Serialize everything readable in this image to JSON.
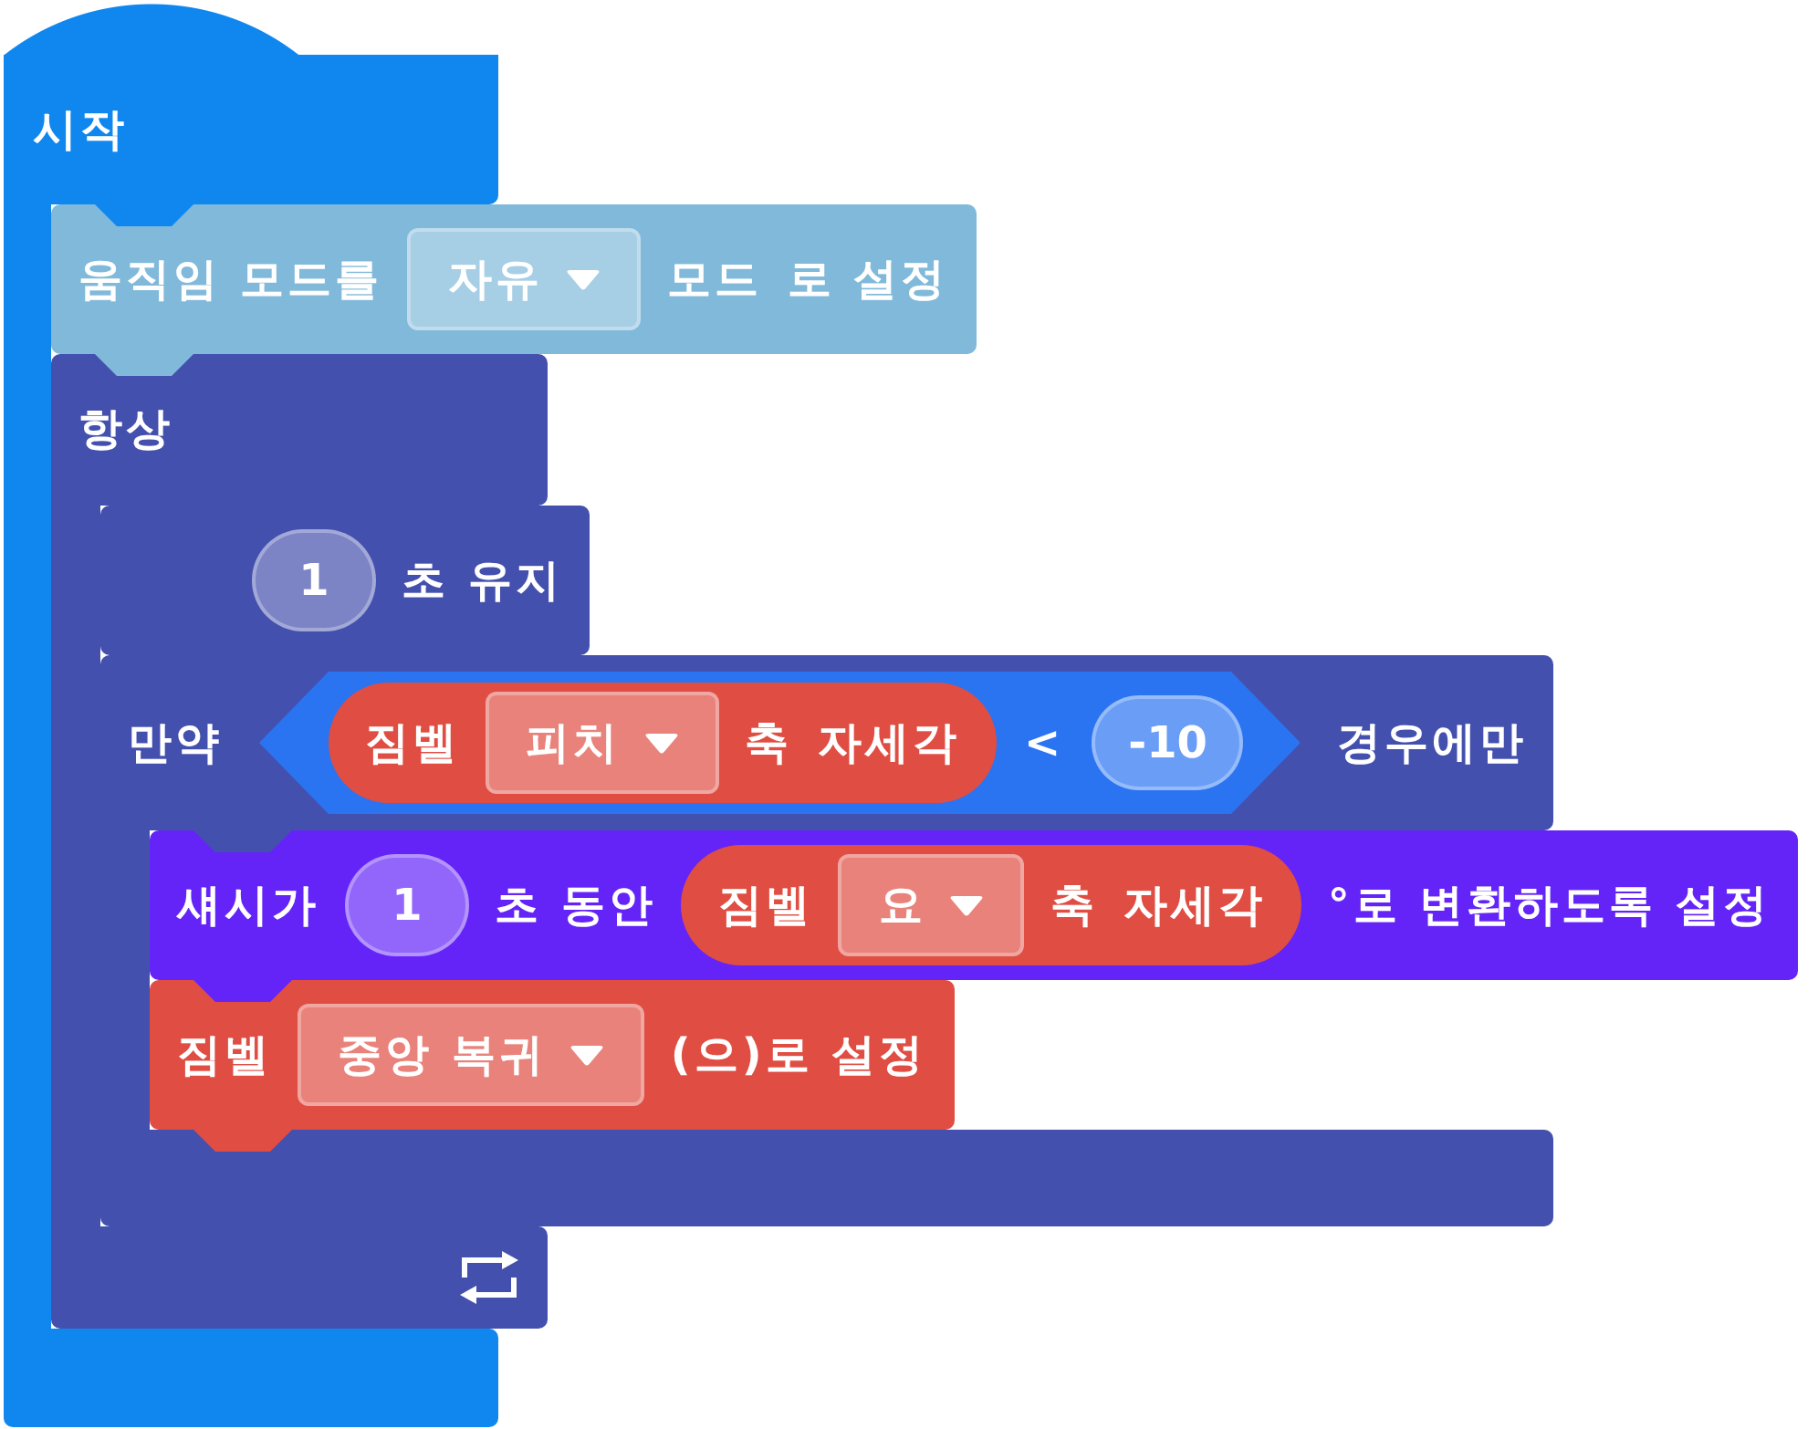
{
  "script": {
    "kind": "hat",
    "color": "#0f87ef",
    "label": "시작",
    "children": [
      {
        "kind": "command",
        "color": "#80b9da",
        "parts": [
          {
            "kind": "text",
            "text": "움직임 모드를"
          },
          {
            "kind": "dropdown",
            "value": "자유"
          },
          {
            "kind": "text",
            "text": "모드"
          },
          {
            "kind": "text",
            "text": "로 설정"
          }
        ]
      },
      {
        "kind": "forever",
        "color": "#4450ae",
        "label": "항상",
        "children": [
          {
            "kind": "command",
            "color": "#4450ae",
            "parts": [
              {
                "kind": "number",
                "value": "1"
              },
              {
                "kind": "text",
                "text": "초 유지"
              }
            ]
          },
          {
            "kind": "if",
            "color": "#4450ae",
            "parts": [
              {
                "kind": "text",
                "text": "만약"
              },
              {
                "kind": "condition",
                "color": "#2a74f2",
                "parts": [
                  {
                    "kind": "reporter",
                    "color": "#e04d42",
                    "parts": [
                      {
                        "kind": "text",
                        "text": "짐벨"
                      },
                      {
                        "kind": "dropdown",
                        "value": "피치"
                      },
                      {
                        "kind": "text",
                        "text": "축"
                      },
                      {
                        "kind": "text",
                        "text": "자세각"
                      }
                    ]
                  },
                  {
                    "kind": "text",
                    "text": "<"
                  },
                  {
                    "kind": "number",
                    "value": "-10"
                  }
                ]
              },
              {
                "kind": "text",
                "text": "경우에만"
              }
            ],
            "children": [
              {
                "kind": "command",
                "color": "#6424f8",
                "parts": [
                  {
                    "kind": "text",
                    "text": "섀시가"
                  },
                  {
                    "kind": "number",
                    "value": "1"
                  },
                  {
                    "kind": "text",
                    "text": "초 동안"
                  },
                  {
                    "kind": "reporter",
                    "color": "#e04d42",
                    "parts": [
                      {
                        "kind": "text",
                        "text": "짐벨"
                      },
                      {
                        "kind": "dropdown",
                        "value": "요"
                      },
                      {
                        "kind": "text",
                        "text": "축"
                      },
                      {
                        "kind": "text",
                        "text": "자세각"
                      }
                    ]
                  },
                  {
                    "kind": "text",
                    "text": "°로 변환하도록 설정"
                  }
                ]
              },
              {
                "kind": "command",
                "color": "#e04d42",
                "parts": [
                  {
                    "kind": "text",
                    "text": "짐벨"
                  },
                  {
                    "kind": "dropdown",
                    "value": "중앙 복귀"
                  },
                  {
                    "kind": "text",
                    "text": "(으)로 설정"
                  }
                ]
              }
            ]
          }
        ]
      }
    ]
  }
}
